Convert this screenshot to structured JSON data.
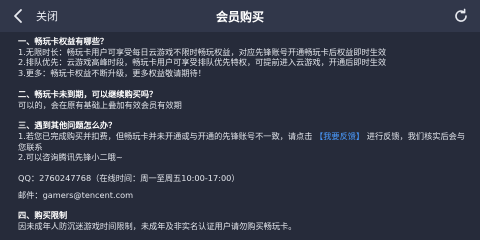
{
  "header": {
    "back_label": "关闭",
    "title": "会员购买"
  },
  "sections": {
    "rights": {
      "title": "一、畅玩卡权益有哪些？",
      "lines": [
        "1.无限时长：畅玩卡用户可享受每日云游戏不限时畅玩权益，对应先锋账号开通畅玩卡后权益即时生效",
        "2.排队优先：云游戏高峰时段，畅玩卡用户可享受排队优先特权，可提前进入云游戏，开通后即时生效",
        "3.更多：畅玩卡权益不断升级，更多权益敬请期待！"
      ]
    },
    "renew": {
      "title": "二、畅玩卡未到期，可以继续购买吗？",
      "lines": [
        "可以的，会在原有基础上叠加有效会员有效期"
      ]
    },
    "help": {
      "title": "三、遇到其他问题怎么办？",
      "line1_pre": "1.若您已完成购买并扣费，但畅玩卡并未开通或与开通的先锋账号不一致，请点击",
      "line1_link": "【我要反馈】",
      "line1_post": "进行反馈，我们核实后会与您联系",
      "line2": "2.可以咨询腾讯先锋小二哦~"
    },
    "contact": {
      "qq": "QQ：2760247768（在线时间：周一至周五10:00-17:00）",
      "email": "邮件：gamers@tencent.com"
    },
    "limit": {
      "title": "四、购买限制",
      "lines": [
        "因未成年人防沉迷游戏时间限制，未成年及非实名认证用户请勿购买畅玩卡。"
      ]
    }
  }
}
